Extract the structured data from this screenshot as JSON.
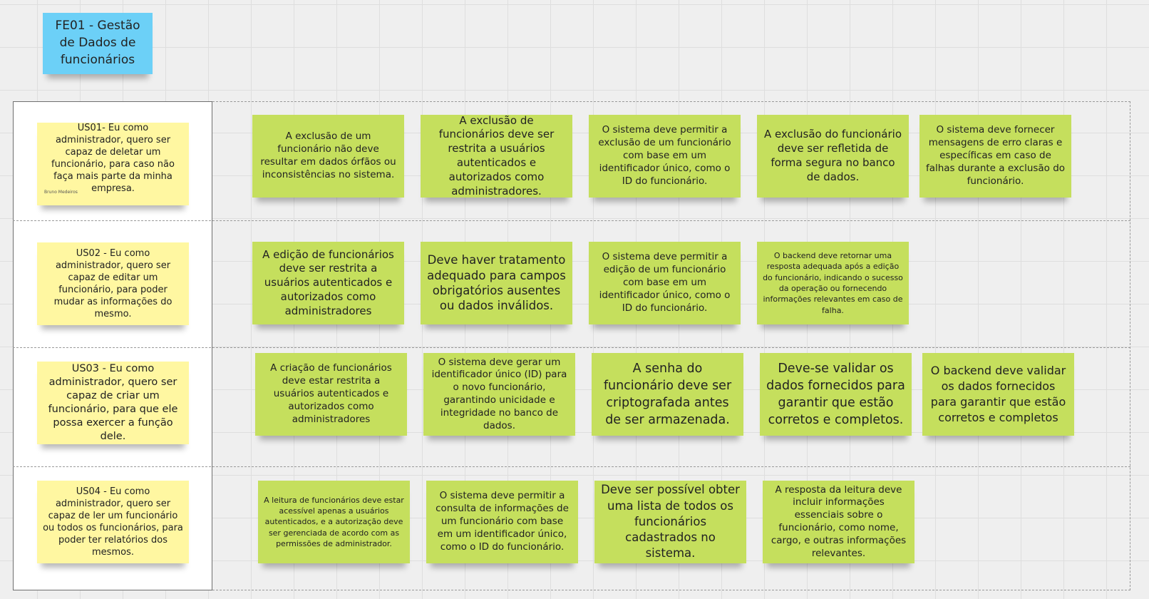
{
  "feature": {
    "title": "FE01 - Gestão de Dados de funcionários",
    "color": "#6cd0f7"
  },
  "colors": {
    "story_note": "#fff7a1",
    "requirement_note": "#c5df5d",
    "canvas": "#efefef"
  },
  "stories": [
    {
      "text": "US01- Eu como administrador, quero ser capaz de deletar um funcionário, para caso não faça mais parte da minha empresa.",
      "author": "Bruno Medeiros",
      "requirements": [
        "A exclusão de um funcionário não deve resultar em dados órfãos ou inconsistências no sistema.",
        "A exclusão de funcionários deve ser restrita a usuários autenticados e autorizados como administradores.",
        "O sistema deve permitir a exclusão de um funcionário com base em um identificador único, como o ID do funcionário.",
        "A exclusão do funcionário deve ser refletida de forma segura no banco de dados.",
        "O sistema deve fornecer mensagens de erro claras e específicas em caso de falhas durante a exclusão do funcionário."
      ]
    },
    {
      "text": "US02 - Eu como administrador, quero ser capaz de editar um funcionário, para poder mudar as informações do mesmo.",
      "requirements": [
        "A edição de funcionários deve ser restrita a usuários autenticados e autorizados como administradores",
        "Deve haver tratamento adequado para campos obrigatórios ausentes ou dados inválidos.",
        "O sistema deve permitir a edição de um funcionário com base em um identificador único, como o ID do funcionário.",
        "O backend deve retornar uma resposta adequada após a edição do funcionário, indicando o sucesso da operação ou fornecendo informações relevantes em caso de falha."
      ]
    },
    {
      "text": "US03 -  Eu como administrador, quero ser capaz de criar um funcionário, para que ele possa exercer a função dele.",
      "requirements": [
        "A criação de funcionários deve estar restrita a usuários autenticados e autorizados como administradores",
        "O sistema deve gerar um identificador único (ID) para o novo funcionário, garantindo unicidade e integridade no banco de dados.",
        "A senha do funcionário deve ser criptografada antes de ser armazenada.",
        "Deve-se validar os dados fornecidos para garantir que estão corretos e completos.",
        "O backend deve validar os dados fornecidos para garantir que estão corretos e completos"
      ]
    },
    {
      "text": "US04 - Eu como administrador, quero ser capaz de ler um funcionário ou todos os funcionários, para poder ter relatórios dos mesmos.",
      "requirements": [
        "A leitura de funcionários deve estar acessível apenas a usuários autenticados, e a autorização deve ser gerenciada de acordo com as permissões de administrador.",
        "O sistema deve permitir a consulta de informações de um funcionário com base em um identificador único, como o ID do funcionário.",
        "Deve ser possível obter uma lista de todos os funcionários cadastrados no sistema.",
        "A resposta da leitura deve incluir informações essenciais sobre o funcionário, como nome, cargo, e outras informações relevantes."
      ]
    }
  ]
}
